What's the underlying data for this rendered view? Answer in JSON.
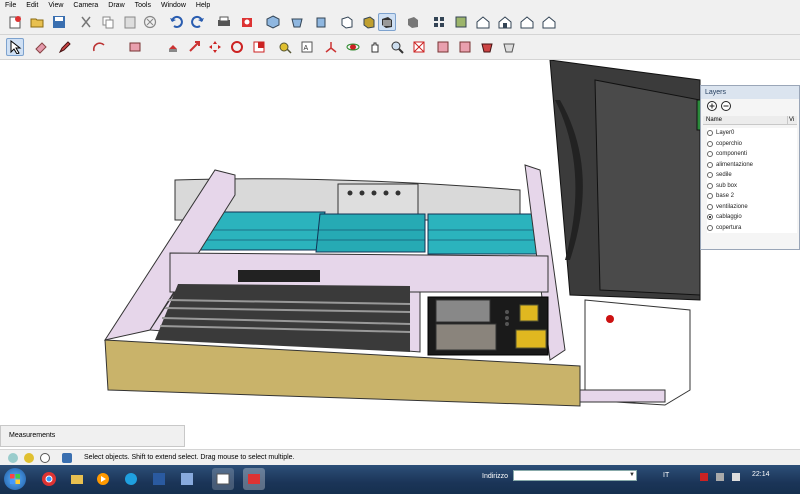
{
  "menu": [
    "File",
    "Edit",
    "View",
    "Camera",
    "Draw",
    "Tools",
    "Window",
    "Help"
  ],
  "toolbar1": [
    "new-file-icon",
    "open-folder-icon",
    "save-icon",
    "cut-icon",
    "copy-icon",
    "paste-icon",
    "erase-icon",
    "undo-icon",
    "redo-icon",
    "print-icon",
    "model-info-icon",
    "iso-view-icon",
    "top-view-icon",
    "front-view-icon",
    "right-view-icon",
    "back-view-icon",
    "left-view-icon",
    "xray-style-icon",
    "wireframe-style-icon",
    "hidden-line-style-icon",
    "shaded-style-icon",
    "shaded-texture-style-icon",
    "monochrome-style-icon",
    "warehouse-icon",
    "component-icon",
    "house-icon",
    "share-icon",
    "extension-icon"
  ],
  "toolbar2": [
    "select-icon",
    "eraser-icon",
    "pencil-icon",
    "arc-icon",
    "rectangle-icon",
    "push-pull-icon",
    "move-icon",
    "rotate-icon",
    "follow-me-icon",
    "scale-icon",
    "offset-icon",
    "tape-measure-icon",
    "text-icon",
    "axes-icon",
    "orbit-icon",
    "pan-icon",
    "zoom-icon",
    "zoom-extents-icon",
    "section-plane-icon",
    "walk-icon",
    "look-around-icon"
  ],
  "layers": {
    "title": "Layers",
    "col_name": "Name",
    "col_v": "Vi",
    "items": [
      {
        "name": "Layer0",
        "selected": false
      },
      {
        "name": "coperchio",
        "selected": false
      },
      {
        "name": "componenti",
        "selected": false
      },
      {
        "name": "alimentazione",
        "selected": false
      },
      {
        "name": "sedile",
        "selected": false
      },
      {
        "name": "sub box",
        "selected": false
      },
      {
        "name": "base 2",
        "selected": false
      },
      {
        "name": "ventilazione",
        "selected": false
      },
      {
        "name": "cablaggio",
        "selected": true
      },
      {
        "name": "copertura",
        "selected": false
      }
    ]
  },
  "measurements_label": "Measurements",
  "status_text": "Select objects. Shift to extend select. Drag mouse to select multiple.",
  "taskbar": {
    "address_label": "Indirizzo",
    "lang": "IT",
    "time": "22:14"
  },
  "colors": {
    "toolbar_bg": "#f0f0f0",
    "taskbar": "#1b3558",
    "model_tan": "#c9b36a",
    "model_pink": "#e6d6ea",
    "model_teal": "#27aab4",
    "model_dark": "#3a3a3a"
  }
}
